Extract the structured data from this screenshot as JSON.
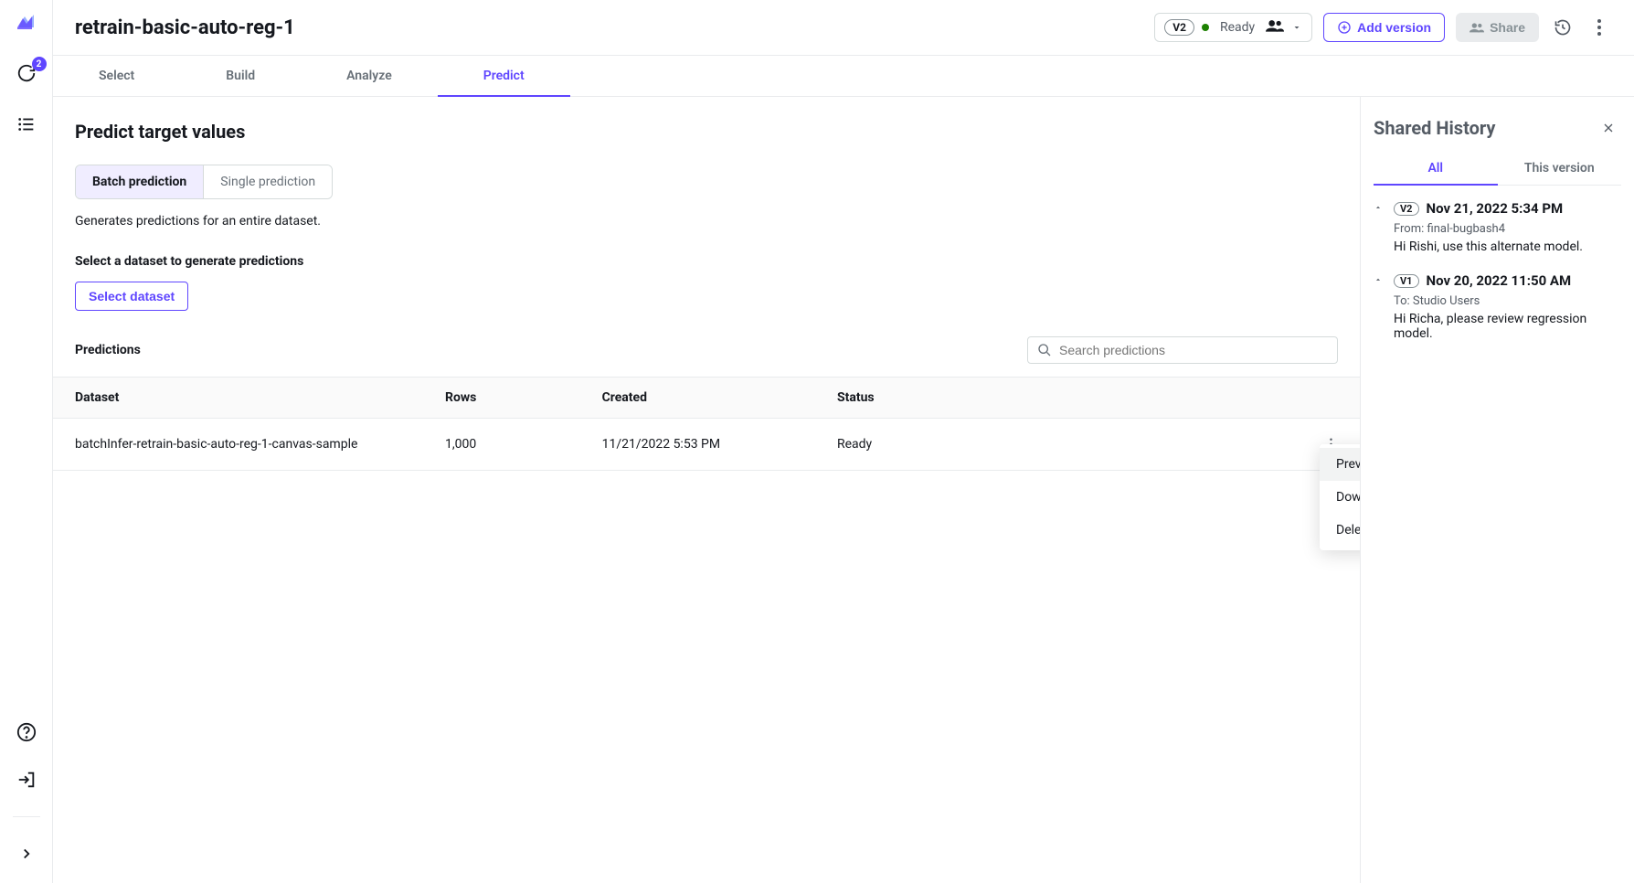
{
  "header": {
    "title": "retrain-basic-auto-reg-1",
    "version_pill": "V2",
    "status": "Ready",
    "add_version": "Add version",
    "share": "Share"
  },
  "left_rail": {
    "badge": "2"
  },
  "tabs": [
    {
      "label": "Select",
      "active": false
    },
    {
      "label": "Build",
      "active": false
    },
    {
      "label": "Analyze",
      "active": false
    },
    {
      "label": "Predict",
      "active": true
    }
  ],
  "predict": {
    "heading": "Predict target values",
    "subtabs": {
      "batch": "Batch prediction",
      "single": "Single prediction",
      "active": "batch"
    },
    "description": "Generates predictions for an entire dataset.",
    "select_dataset_label": "Select a dataset to generate predictions",
    "select_dataset_btn": "Select dataset",
    "predictions_label": "Predictions",
    "search_placeholder": "Search predictions",
    "columns": {
      "dataset": "Dataset",
      "rows": "Rows",
      "created": "Created",
      "status": "Status"
    },
    "rows": [
      {
        "dataset": "batchInfer-retrain-basic-auto-reg-1-canvas-sample",
        "rows": "1,000",
        "created": "11/21/2022 5:53 PM",
        "status": "Ready"
      }
    ],
    "context_menu": {
      "preview": "Preview",
      "download": "Download",
      "delete": "Delete"
    }
  },
  "shared_history": {
    "title": "Shared History",
    "tabs": {
      "all": "All",
      "this_version": "This version",
      "active": "all"
    },
    "items": [
      {
        "version": "V2",
        "timestamp": "Nov 21, 2022 5:34 PM",
        "meta": "From: final-bugbash4",
        "body": "Hi Rishi, use this alternate model."
      },
      {
        "version": "V1",
        "timestamp": "Nov 20, 2022 11:50 AM",
        "meta": "To: Studio Users",
        "body": "Hi Richa, please review regression model."
      }
    ]
  }
}
